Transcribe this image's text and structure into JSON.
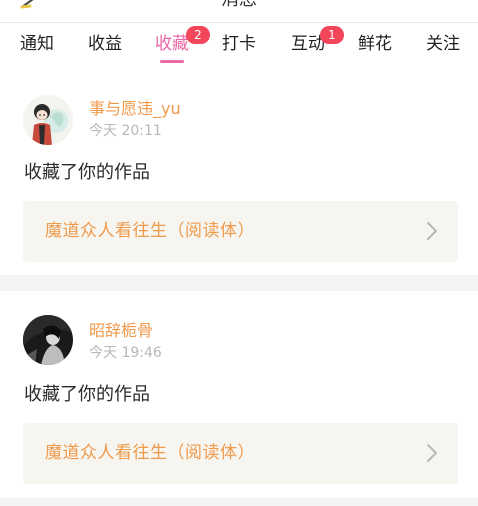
{
  "header": {
    "title": "消息"
  },
  "tabs": [
    {
      "label": "通知",
      "active": false,
      "badge": null
    },
    {
      "label": "收益",
      "active": false,
      "badge": null
    },
    {
      "label": "收藏",
      "active": true,
      "badge": "2"
    },
    {
      "label": "打卡",
      "active": false,
      "badge": null
    },
    {
      "label": "互动",
      "active": false,
      "badge": "1"
    },
    {
      "label": "鲜花",
      "active": false,
      "badge": null
    },
    {
      "label": "关注",
      "active": false,
      "badge": null
    }
  ],
  "notifications": [
    {
      "username": "事与愿违_yu",
      "time": "今天 20:11",
      "action": "收藏了你的作品",
      "work_title": "魔道众人看往生（阅读体）"
    },
    {
      "username": "昭辞栀骨",
      "time": "今天 19:46",
      "action": "收藏了你的作品",
      "work_title": "魔道众人看往生（阅读体）"
    }
  ],
  "colors": {
    "accent": "#e968a5",
    "username": "#f09a4c",
    "badge": "#f2475a",
    "work_row_bg": "#f6f5ef",
    "separator": "#f4f4f4"
  }
}
